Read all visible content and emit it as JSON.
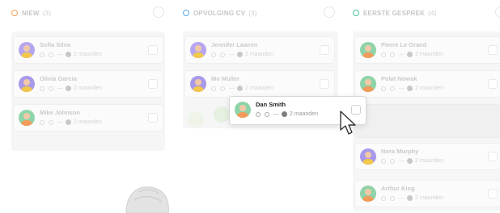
{
  "colors": {
    "new": "#f5a35b",
    "followup": "#5aa9e6",
    "interview": "#4fc3a1",
    "header_text": "#c6c6c6"
  },
  "columns": [
    {
      "title": "NIEW",
      "count": "(3)",
      "cards": [
        {
          "name": "Sofia Silva",
          "meta": "2 maanden"
        },
        {
          "name": "Olivia Garcia",
          "meta": "2 maanden"
        },
        {
          "name": "Mike Johnson",
          "meta": "2 maanden"
        }
      ]
    },
    {
      "title": "OPVOLGING CV",
      "count": "(3)",
      "cards": [
        {
          "name": "Jennifer Lawren",
          "meta": "2 maanden"
        },
        {
          "name": "Mo Muller",
          "meta": "2 maanden"
        }
      ]
    },
    {
      "title": "EERSTE GESPREK",
      "count": "(4)",
      "cards": [
        {
          "name": "Pierre Le Grand",
          "meta": "2 maanden"
        },
        {
          "name": "Polat Nowak",
          "meta": "2 maanden"
        },
        {
          "name": "Nora Murphy",
          "meta": "2 maanden"
        },
        {
          "name": "Arthur King",
          "meta": "2 maanden"
        }
      ]
    }
  ],
  "dragging_card": {
    "name": "Dan Smith",
    "meta": "2 maanden"
  },
  "meta_dash": "—"
}
